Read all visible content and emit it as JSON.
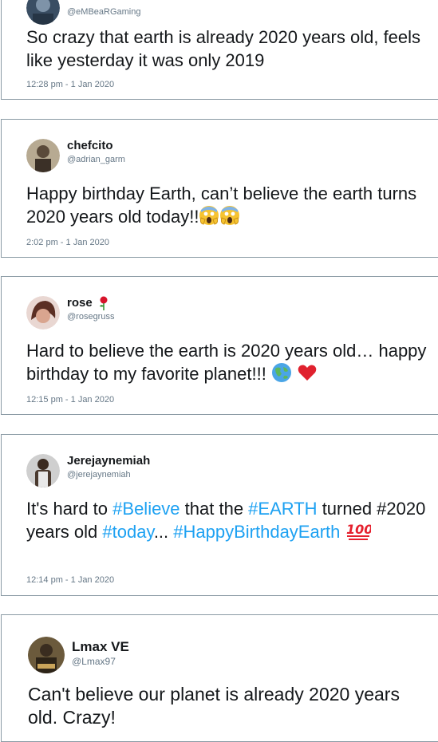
{
  "tweets": [
    {
      "handle": "@eMBeaRGaming",
      "text": "So crazy that earth is already 2020 years old, feels like yesterday it was only 2019",
      "time": "12:28 pm - 1 Jan 2020"
    },
    {
      "name": "chefcito",
      "handle": "@adrian_garm",
      "text": "Happy birthday Earth, can’t believe the earth turns 2020 years old today!!",
      "time": "2:02 pm - 1 Jan 2020"
    },
    {
      "name": "rose",
      "handle": "@rosegruss",
      "text": "Hard to believe the earth is 2020 years old… happy birthday to my favorite planet!!!",
      "time": "12:15 pm - 1 Jan 2020"
    },
    {
      "name": "Jerejaynemiah",
      "handle": "@jerejaynemiah",
      "text_parts": [
        "It's hard to ",
        "#Believe",
        " that the ",
        "#EARTH",
        " turned #2020 years old ",
        "#today",
        "... ",
        "#HappyBirthdayEarth"
      ],
      "time": "12:14 pm - 1 Jan 2020"
    },
    {
      "name": "Lmax VE",
      "handle": "@Lmax97",
      "text": "Can't believe our planet is already 2020 years old. Crazy!"
    }
  ],
  "colors": {
    "hashtag": "#1da1f2",
    "border": "#8a9aa4",
    "muted": "#657786"
  }
}
